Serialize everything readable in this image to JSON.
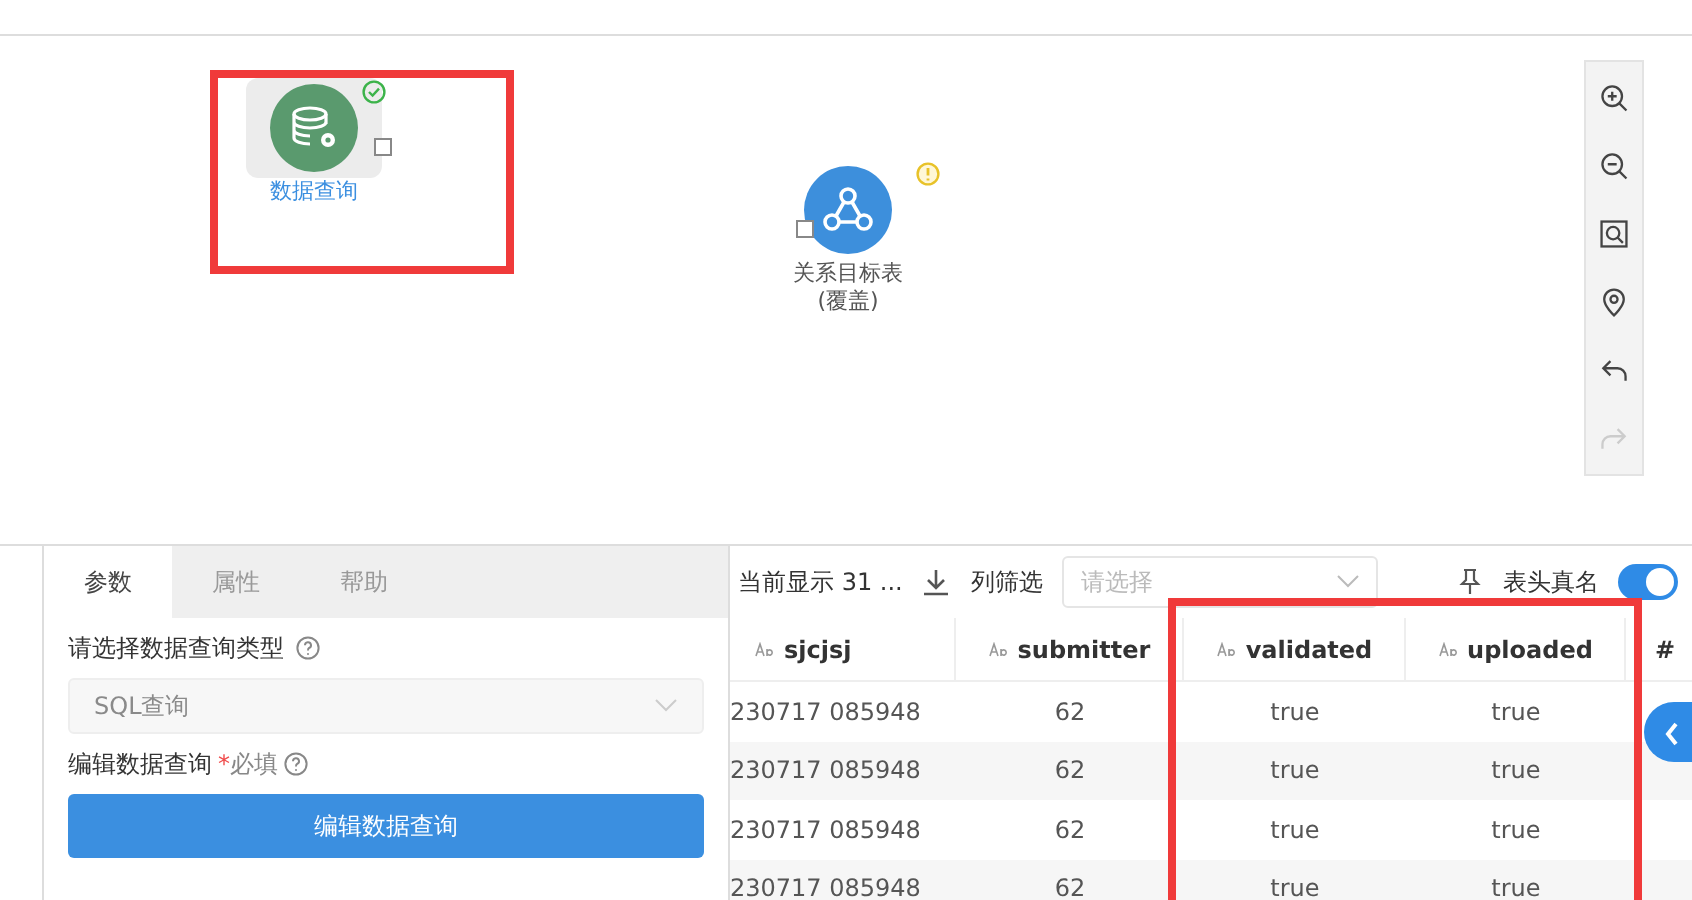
{
  "canvas": {
    "nodes": [
      {
        "label": "数据查询",
        "kind": "query",
        "success": true,
        "warning": false,
        "highlighted": true,
        "selected": true
      },
      {
        "label": "关系目标表",
        "sublabel": "(覆盖)",
        "kind": "target",
        "success": false,
        "warning": true,
        "highlighted": false,
        "selected": false
      }
    ],
    "tools": [
      {
        "kind": "zoom-in",
        "disabled": false
      },
      {
        "kind": "zoom-out",
        "disabled": false
      },
      {
        "kind": "fit",
        "disabled": false
      },
      {
        "kind": "locate",
        "disabled": false
      },
      {
        "kind": "undo",
        "disabled": false
      },
      {
        "kind": "redo",
        "disabled": true
      }
    ]
  },
  "panel": {
    "tabs": [
      {
        "label": "参数",
        "selected": true
      },
      {
        "label": "属性",
        "selected": false
      },
      {
        "label": "帮助",
        "selected": false
      }
    ],
    "query_type_label": "请选择数据查询类型",
    "query_type_value": "SQL查询",
    "edit_label": "编辑数据查询",
    "required_mark": "*",
    "required_text": "必填",
    "edit_button": "编辑数据查询"
  },
  "results": {
    "count_text": "当前显示 31 ...",
    "filter_label": "列筛选",
    "filter_placeholder": "请选择",
    "header_toggle_label": "表头真名",
    "header_toggle_on": true,
    "columns": [
      {
        "name": "sjcjsj",
        "highlighted": false
      },
      {
        "name": "submitter",
        "highlighted": false
      },
      {
        "name": "validated",
        "highlighted": true
      },
      {
        "name": "uploaded",
        "highlighted": true
      },
      {
        "name": "#",
        "highlighted": false
      }
    ],
    "rows": [
      [
        "230717 085948",
        "62",
        "true",
        "true"
      ],
      [
        "230717 085948",
        "62",
        "true",
        "true"
      ],
      [
        "230717 085948",
        "62",
        "true",
        "true"
      ],
      [
        "230717 085948",
        "62",
        "true",
        "true"
      ]
    ]
  }
}
